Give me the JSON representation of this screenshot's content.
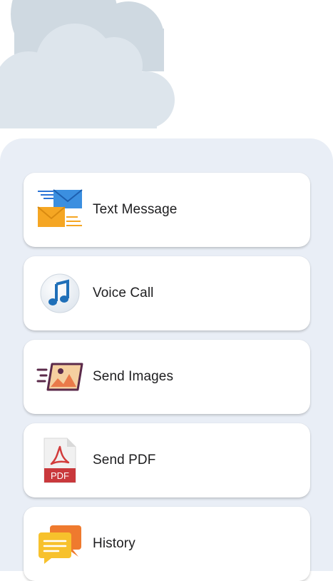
{
  "menu": {
    "items": [
      {
        "id": "text-message",
        "label": "Text Message",
        "icon": "envelopes-icon"
      },
      {
        "id": "voice-call",
        "label": "Voice Call",
        "icon": "music-note-icon"
      },
      {
        "id": "send-images",
        "label": "Send Images",
        "icon": "image-icon"
      },
      {
        "id": "send-pdf",
        "label": "Send PDF",
        "icon": "pdf-file-icon"
      },
      {
        "id": "history",
        "label": "History",
        "icon": "chat-bubbles-icon"
      }
    ],
    "pdf_badge": "PDF"
  },
  "colors": {
    "cloud_back": "#cfd9e1",
    "cloud_front": "#dde5ec",
    "panel_bg": "#e9eef6",
    "card_bg": "#ffffff"
  }
}
